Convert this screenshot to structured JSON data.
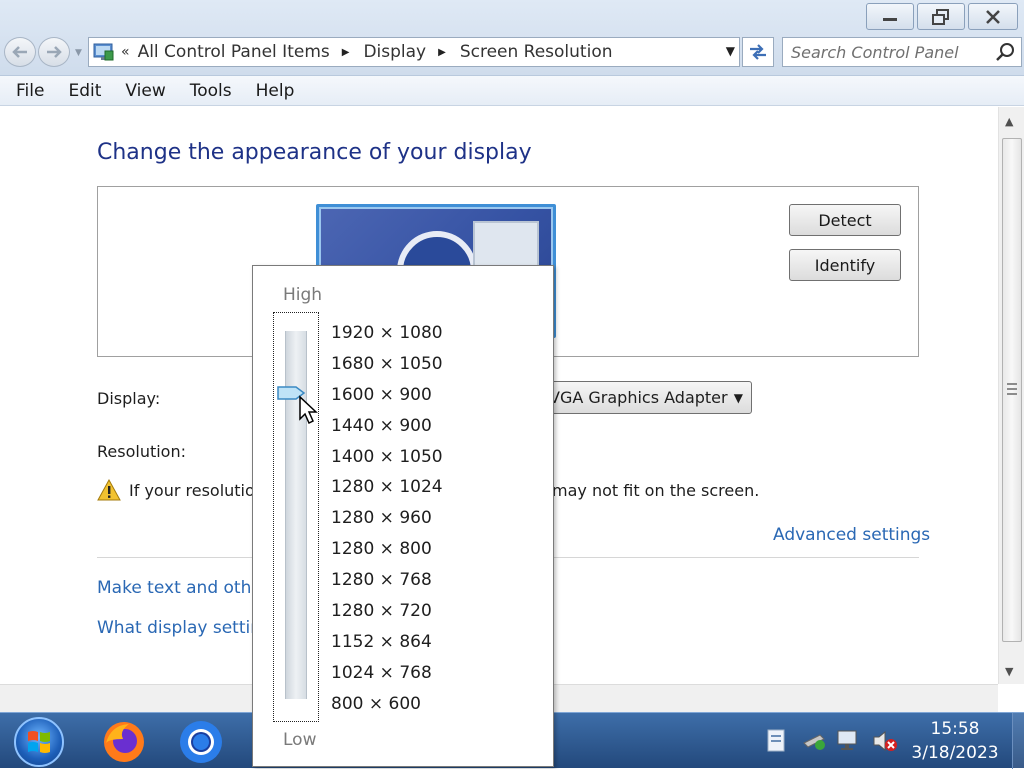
{
  "address": {
    "breadcrumb": [
      "All Control Panel Items",
      "Display",
      "Screen Resolution"
    ]
  },
  "search": {
    "placeholder": "Search Control Panel"
  },
  "menu": [
    "File",
    "Edit",
    "View",
    "Tools",
    "Help"
  ],
  "page": {
    "heading": "Change the appearance of your display",
    "detect_label": "Detect",
    "identify_label": "Identify",
    "display_label": "Display:",
    "display_value": "VGA Graphics Adapter",
    "resolution_label": "Resolution:",
    "warning_left": "If your resolutio",
    "warning_right": "may not fit on the screen.",
    "advanced_link": "Advanced settings",
    "link_text_size": "Make text and othe",
    "link_display_settings": "What display setting"
  },
  "popup": {
    "high_label": "High",
    "low_label": "Low",
    "resolutions": [
      "1920 × 1080",
      "1680 × 1050",
      "1600 × 900",
      "1440 × 900",
      "1400 × 1050",
      "1280 × 1024",
      "1280 × 960",
      "1280 × 800",
      "1280 × 768",
      "1280 × 720",
      "1152 × 864",
      "1024 × 768",
      "800 × 600"
    ],
    "selected": "1600 × 900"
  },
  "taskbar": {
    "time": "15:58",
    "date": "3/18/2023"
  },
  "colors": {
    "heading": "#1e3287",
    "link": "#2a68b4",
    "taskbar": "#23497c"
  }
}
